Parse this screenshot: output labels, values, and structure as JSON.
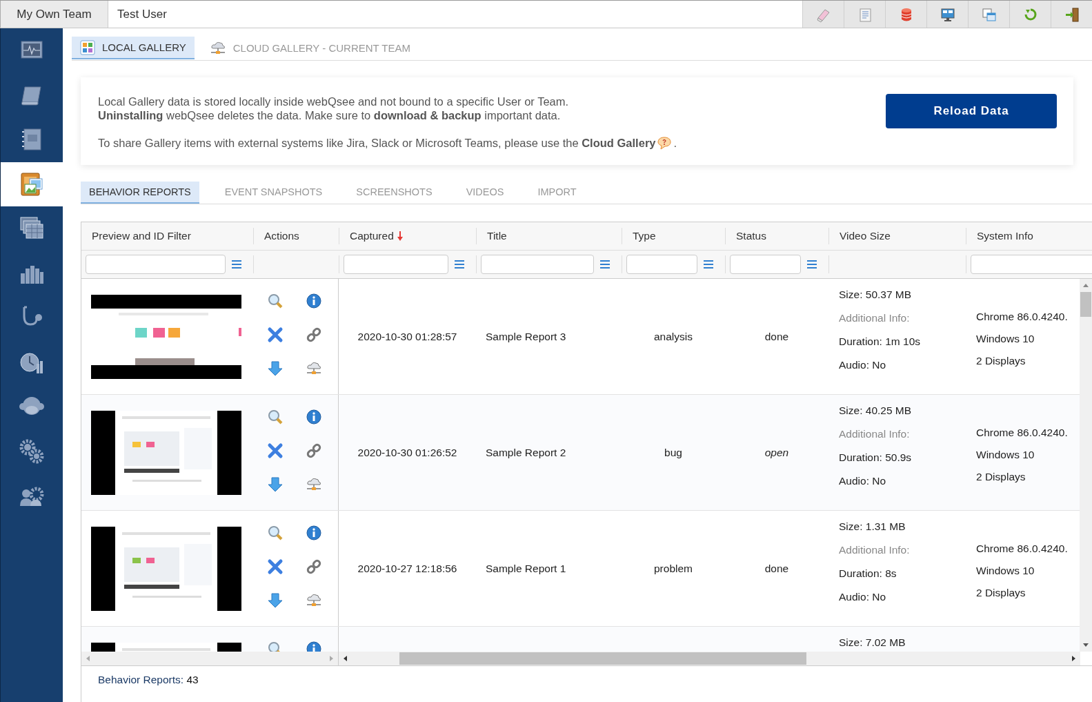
{
  "top_bar": {
    "team": "My Own Team",
    "user": "Test User"
  },
  "sidebar": {
    "items": [
      {
        "selected": false
      },
      {
        "selected": false
      },
      {
        "selected": false
      },
      {
        "selected": true
      },
      {
        "selected": false
      },
      {
        "selected": false
      },
      {
        "selected": false
      },
      {
        "selected": false
      },
      {
        "selected": false
      },
      {
        "selected": false
      },
      {
        "selected": false
      }
    ]
  },
  "gallery_tabs": [
    {
      "label": "LOCAL GALLERY",
      "selected": true
    },
    {
      "label": "CLOUD GALLERY - CURRENT TEAM",
      "selected": false
    }
  ],
  "info_card": {
    "lines": [
      "Local Gallery data is stored locally inside webQsee and not bound to a specific User or Team.",
      "**Uninstalling** webQsee deletes the data. Make sure to **download & backup** important data."
    ],
    "share_text": "To share Gallery items with external systems like Jira, Slack or Microsoft Teams, please use the **Cloud Gallery**",
    "share_end": ".",
    "button": "Reload Data"
  },
  "section_tabs": [
    {
      "label": "BEHAVIOR REPORTS",
      "selected": true
    },
    {
      "label": "EVENT SNAPSHOTS",
      "selected": false
    },
    {
      "label": "SCREENSHOTS",
      "selected": false
    },
    {
      "label": "VIDEOS",
      "selected": false
    },
    {
      "label": "IMPORT",
      "selected": false
    }
  ],
  "table": {
    "columns": [
      {
        "label": "Preview and ID Filter",
        "filter": true,
        "sorted": false
      },
      {
        "label": "Actions",
        "filter": false,
        "sorted": false
      },
      {
        "label": "Captured",
        "filter": true,
        "sorted": true
      },
      {
        "label": "Title",
        "filter": true,
        "sorted": false
      },
      {
        "label": "Type",
        "filter": true,
        "sorted": false
      },
      {
        "label": "Status",
        "filter": true,
        "sorted": false
      },
      {
        "label": "Video Size",
        "filter": false,
        "sorted": false
      },
      {
        "label": "System Info",
        "filter": true,
        "sorted": false
      }
    ],
    "rows": [
      {
        "captured": "2020-10-30 01:28:57",
        "title": "Sample Report 3",
        "type": "analysis",
        "status": "done",
        "status_italic": false,
        "video_size": {
          "size": "Size: 50.37 MB",
          "additional": "Additional Info:",
          "duration": "Duration: 1m 10s",
          "audio": "Audio: No"
        },
        "system_info": [
          "Chrome 86.0.4240.",
          "Windows 10",
          "2 Displays"
        ]
      },
      {
        "captured": "2020-10-30 01:26:52",
        "title": "Sample Report 2",
        "type": "bug",
        "status": "open",
        "status_italic": true,
        "video_size": {
          "size": "Size: 40.25 MB",
          "additional": "Additional Info:",
          "duration": "Duration: 50.9s",
          "audio": "Audio: No"
        },
        "system_info": [
          "Chrome 86.0.4240.",
          "Windows 10",
          "2 Displays"
        ]
      },
      {
        "captured": "2020-10-27 12:18:56",
        "title": "Sample Report 1",
        "type": "problem",
        "status": "done",
        "status_italic": false,
        "video_size": {
          "size": "Size: 1.31 MB",
          "additional": "Additional Info:",
          "duration": "Duration: 8s",
          "audio": "Audio: No"
        },
        "system_info": [
          "Chrome 86.0.4240.",
          "Windows 10",
          "2 Displays"
        ]
      },
      {
        "video_size": {
          "size": "Size: 7.02 MB"
        }
      }
    ]
  },
  "footer": {
    "text": "Behavior Reports: **43**"
  }
}
